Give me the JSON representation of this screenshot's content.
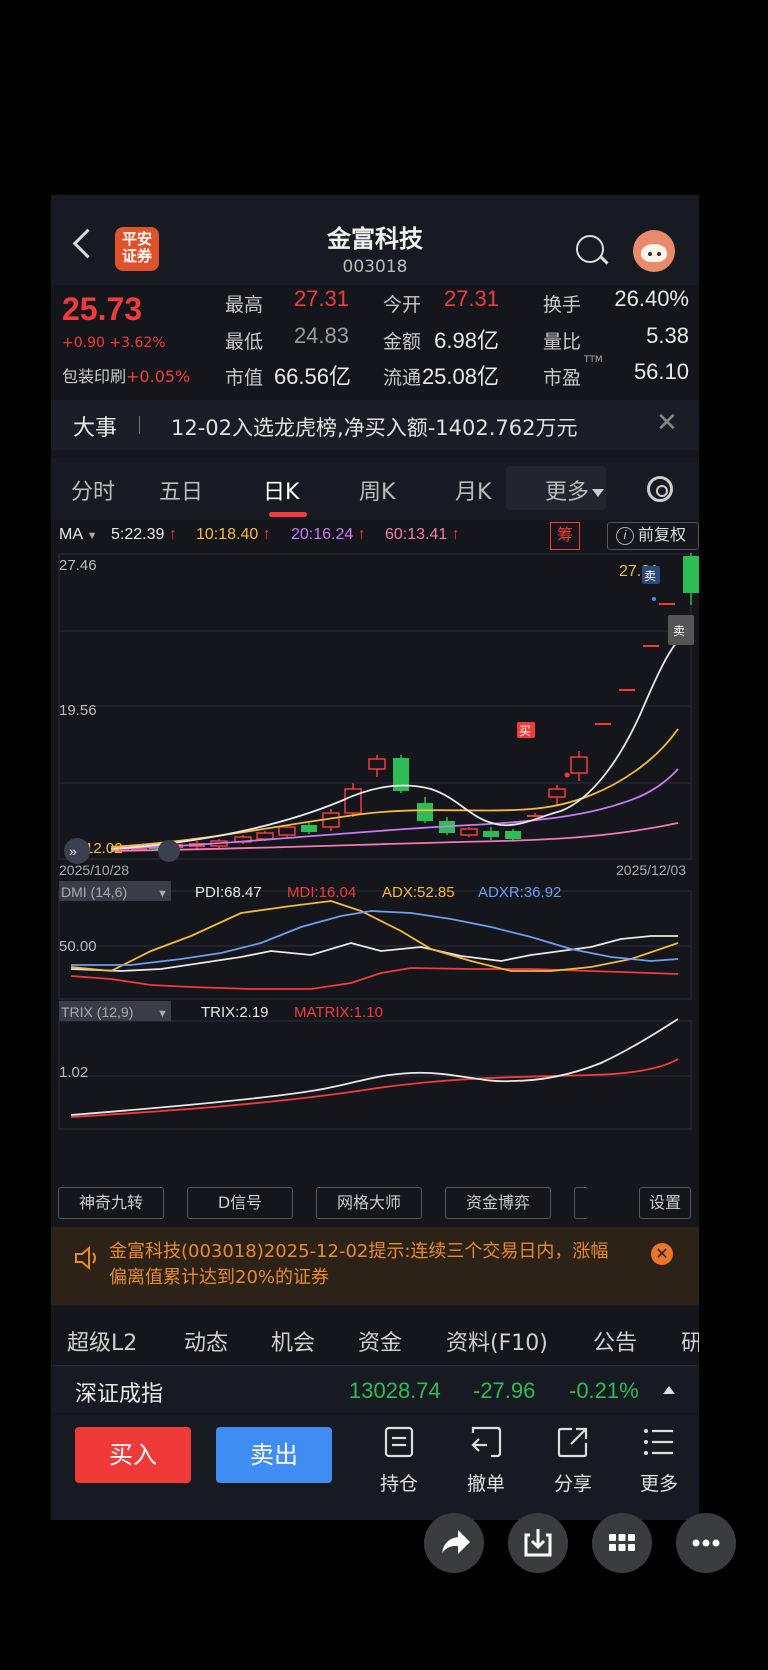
{
  "header": {
    "title": "金富科技",
    "code": "003018",
    "logo_text": "平安证券"
  },
  "quote": {
    "price": "25.73",
    "change": "+0.90 +3.62%",
    "sector_name": "包装印刷",
    "sector_change": "+0.05%",
    "cells": [
      {
        "label": "最高",
        "value": "27.31",
        "color": "#f23c3c"
      },
      {
        "label": "今开",
        "value": "27.31",
        "color": "#f23c3c"
      },
      {
        "label": "换手",
        "value": "26.40%",
        "color": "#e8e8e8"
      },
      {
        "label": "最低",
        "value": "24.83",
        "color": "#9a9a9a"
      },
      {
        "label": "金额",
        "value": "6.98亿",
        "color": "#e8e8e8"
      },
      {
        "label": "量比",
        "value": "5.38",
        "color": "#e8e8e8"
      },
      {
        "label": "市值",
        "value": "66.56亿",
        "color": "#e8e8e8"
      },
      {
        "label": "流通",
        "value": "25.08亿",
        "color": "#e8e8e8"
      },
      {
        "label": "市盈",
        "value": "56.10",
        "color": "#e8e8e8"
      }
    ],
    "ttm": "TTM"
  },
  "event": {
    "tag": "大事",
    "text": "12-02入选龙虎榜,净买入额-1402.762万元",
    "close": "✕"
  },
  "tabs": [
    "分时",
    "五日",
    "日K",
    "周K",
    "月K",
    "更多"
  ],
  "ma": {
    "label": "MA",
    "items": [
      {
        "text": "5:22.39",
        "color": "#e8e8e8"
      },
      {
        "text": "10:18.40",
        "color": "#f5b93a"
      },
      {
        "text": "20:16.24",
        "color": "#c77df0"
      },
      {
        "text": "60:13.41",
        "color": "#f07ab4"
      }
    ],
    "arrow": "↑",
    "chou": "筹",
    "fuquan": "前复权"
  },
  "kchart": {
    "y_labels": [
      "27.46",
      "19.56"
    ],
    "last_label": "27.31",
    "low_label": "12.02",
    "start_date": "2025/10/28",
    "end_date": "2025/12/03",
    "buy_mark": "买",
    "sell_mark": "卖"
  },
  "dmi": {
    "label": "DMI (14,6)",
    "pdi": "PDI:68.47",
    "mdi": "MDI:16.04",
    "adx": "ADX:52.85",
    "adxr": "ADXR:36.92",
    "level": "50.00"
  },
  "trix": {
    "label": "TRIX (12,9)",
    "trix": "TRIX:2.19",
    "matrix": "MATRIX:1.10",
    "level": "1.02"
  },
  "tools": [
    "神奇九转",
    "D信号",
    "网格大师",
    "资金博弈",
    "设置"
  ],
  "alert": {
    "text": "金富科技(003018)2025-12-02提示:连续三个交易日内，涨幅偏离值累计达到20%的证券"
  },
  "info_tabs": [
    "超级L2",
    "动态",
    "机会",
    "资金",
    "资料(F10)",
    "公告",
    "研"
  ],
  "index": {
    "name": "深证成指",
    "value": "13028.74",
    "change": "-27.96",
    "pct": "-0.21%"
  },
  "actions": {
    "buy": "买入",
    "sell": "卖出",
    "items": [
      "持仓",
      "撤单",
      "分享",
      "更多"
    ]
  },
  "colors": {
    "up": "#f23c3c",
    "down": "#2dbc55",
    "accent_blue": "#3f8cf2"
  }
}
